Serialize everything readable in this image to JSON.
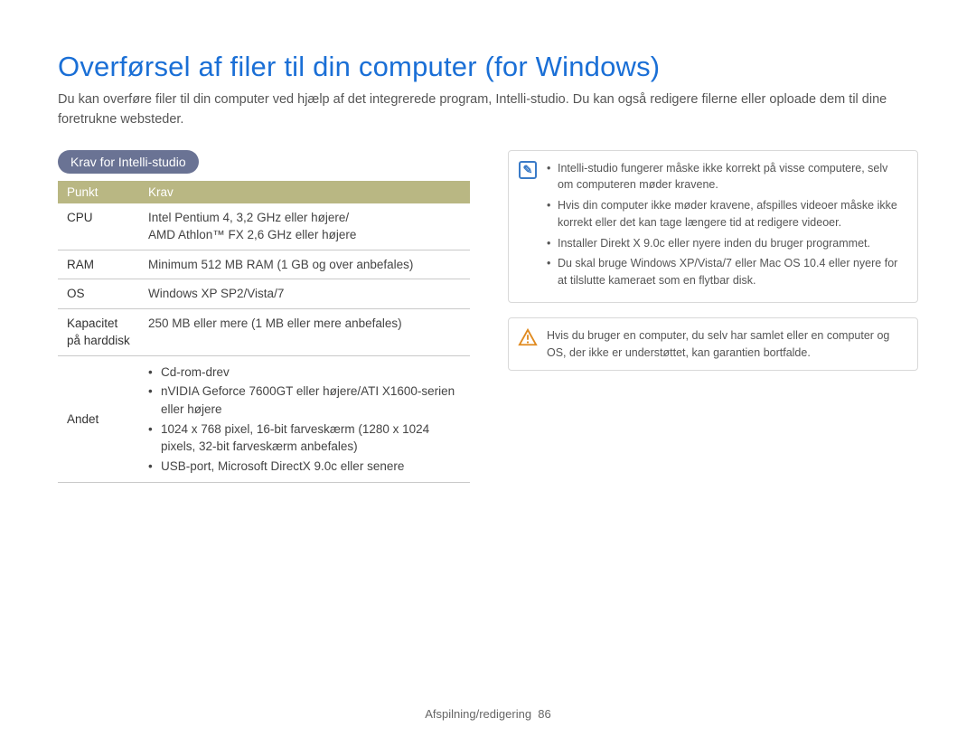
{
  "title": "Overførsel af filer til din computer (for Windows)",
  "intro": "Du kan overføre filer til din computer ved hjælp af det integrerede program, Intelli-studio. Du kan også redigere filerne eller oploade dem til dine foretrukne websteder.",
  "badge": "Krav for Intelli-studio",
  "table": {
    "headers": {
      "c0": "Punkt",
      "c1": "Krav"
    },
    "rows": {
      "cpu": {
        "label": "CPU",
        "value": "Intel Pentium 4, 3,2 GHz eller højere/\nAMD Athlon™ FX 2,6 GHz eller højere"
      },
      "ram": {
        "label": "RAM",
        "value": "Minimum 512 MB RAM (1 GB og over anbefales)"
      },
      "os": {
        "label": "OS",
        "value": "Windows XP SP2/Vista/7"
      },
      "hdd": {
        "label": "Kapacitet på harddisk",
        "value": "250 MB eller mere (1 MB eller mere anbefales)"
      },
      "other": {
        "label": "Andet",
        "items": [
          "Cd-rom-drev",
          "nVIDIA Geforce 7600GT eller højere/ATI X1600-serien eller højere",
          "1024 x 768 pixel, 16-bit farveskærm (1280 x 1024 pixels, 32-bit farveskærm anbefales)",
          "USB-port, Microsoft DirectX 9.0c eller senere"
        ]
      }
    }
  },
  "info_note": {
    "items": [
      "Intelli-studio fungerer måske ikke korrekt på visse computere, selv om computeren møder kravene.",
      "Hvis din computer ikke møder kravene, afspilles videoer måske ikke korrekt eller det kan tage længere tid at redigere videoer.",
      "Installer Direkt X 9.0c eller nyere inden du bruger programmet.",
      "Du skal bruge Windows XP/Vista/7 eller Mac OS 10.4 eller nyere for at tilslutte kameraet som en flytbar disk."
    ]
  },
  "warn_note": "Hvis du bruger en computer, du selv har samlet eller en computer og OS, der ikke er understøttet, kan garantien bortfalde.",
  "footer": {
    "section": "Afspilning/redigering",
    "page": "86"
  }
}
